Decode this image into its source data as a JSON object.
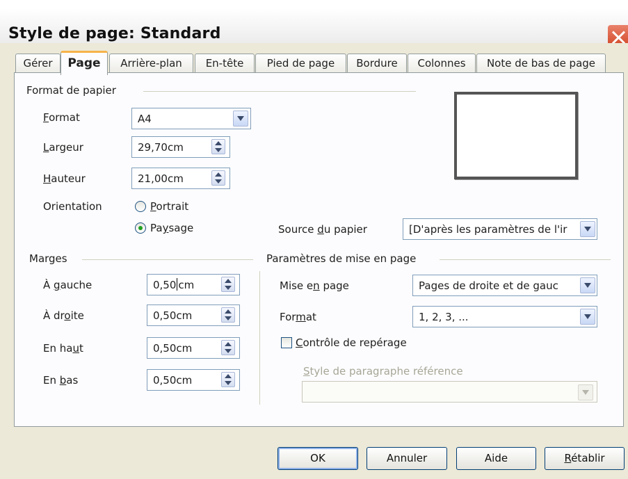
{
  "window": {
    "title": "Style de page: Standard"
  },
  "tabs": [
    {
      "label": "Gérer"
    },
    {
      "label": "Page"
    },
    {
      "label": "Arrière-plan"
    },
    {
      "label": "En-tête"
    },
    {
      "label": "Pied de page"
    },
    {
      "label": "Bordure"
    },
    {
      "label": "Colonnes"
    },
    {
      "label": "Note de bas de page"
    }
  ],
  "paper_format": {
    "group_label": "Format de papier",
    "format": {
      "label_pre": "",
      "label_u": "F",
      "label_post": "ormat",
      "value": "A4"
    },
    "width": {
      "label_pre": "",
      "label_u": "L",
      "label_post": "argeur",
      "value": "29,70cm"
    },
    "height": {
      "label_pre": "",
      "label_u": "H",
      "label_post": "auteur",
      "value": "21,00cm"
    },
    "orientation": {
      "label": "Orientation",
      "portrait": {
        "label_u": "P",
        "label_post": "ortrait",
        "checked": false
      },
      "landscape": {
        "label_pre": "Pa",
        "label_u": "y",
        "label_post": "sage",
        "checked": true
      }
    },
    "paper_source": {
      "label_pre": "Source ",
      "label_u": "d",
      "label_post": "u papier",
      "value": "[D'après les paramètres de l'ir"
    }
  },
  "margins": {
    "group_label": "Marges",
    "left": {
      "label_pre": "À ",
      "label_u": "g",
      "label_post": "auche",
      "value_a": "0,50",
      "value_b": "cm"
    },
    "right": {
      "label_pre": "À dr",
      "label_u": "o",
      "label_post": "ite",
      "value": "0,50cm"
    },
    "top": {
      "label_pre": "En ha",
      "label_u": "u",
      "label_post": "t",
      "value": "0,50cm"
    },
    "bottom": {
      "label_pre": "En ",
      "label_u": "b",
      "label_post": "as",
      "value": "0,50cm"
    }
  },
  "layout_settings": {
    "group_label": "Paramètres de mise en page",
    "page_layout": {
      "label_pre": "Mise e",
      "label_u": "n",
      "label_post": " page",
      "value": "Pages de droite et de gauc"
    },
    "format": {
      "label_pre": "For",
      "label_u": "m",
      "label_post": "at",
      "value": "1, 2, 3, ..."
    },
    "register_true": {
      "label_u": "C",
      "label_post": "ontrôle de repérage",
      "checked": false
    },
    "reference_style": {
      "label_pre": "",
      "label_u": "S",
      "label_post": "tyle de paragraphe référence",
      "value": ""
    }
  },
  "buttons": {
    "ok": "OK",
    "cancel": "Annuler",
    "help": "Aide",
    "reset_u": "R",
    "reset_post": "établir"
  },
  "colors": {
    "dialog_bg": "#ece9d8",
    "panel_bg": "#fcfcfe",
    "active_tab_accent": "#f6b34a",
    "close_button": "#cf3f1e",
    "field_border": "#7f9db9"
  }
}
